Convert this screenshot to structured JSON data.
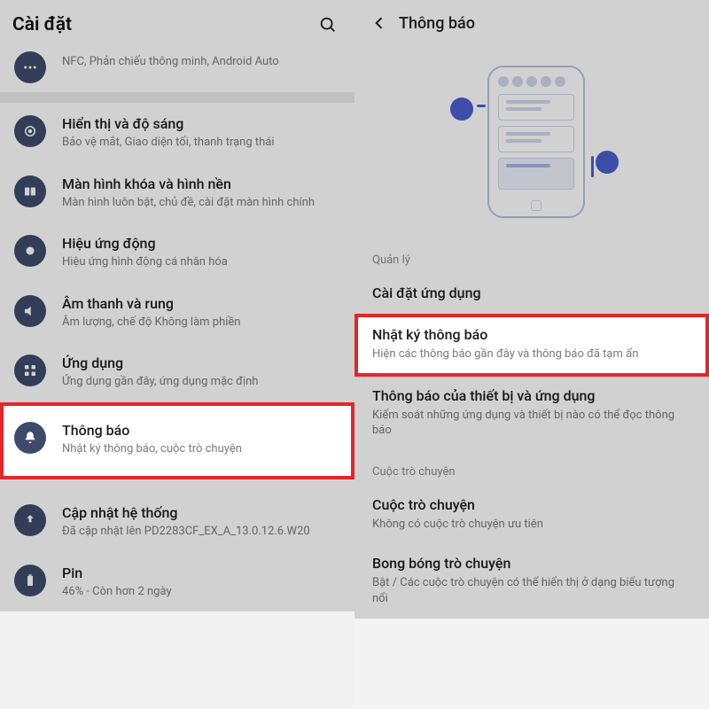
{
  "left": {
    "title": "Cài đặt",
    "items": [
      {
        "icon": "dots",
        "title": "",
        "subtitle": "NFC, Phản chiếu thông minh, Android Auto"
      },
      {
        "icon": "disc",
        "title": "Hiển thị và độ sáng",
        "subtitle": "Bảo vệ mắt, Giao diện tối, thanh trạng thái"
      },
      {
        "icon": "palette",
        "title": "Màn hình khóa và hình nền",
        "subtitle": "Màn hình luôn bật, chủ đề, cài đặt màn hình chính"
      },
      {
        "icon": "motion",
        "title": "Hiệu ứng động",
        "subtitle": "Hiệu ứng hình động cá nhân hóa"
      },
      {
        "icon": "sound",
        "title": "Âm thanh và rung",
        "subtitle": "Âm lượng, chế độ Không làm phiền"
      },
      {
        "icon": "apps",
        "title": "Ứng dụng",
        "subtitle": "Ứng dụng gần đây, ứng dụng mặc định"
      },
      {
        "icon": "bell",
        "title": "Thông báo",
        "subtitle": "Nhật ký thông báo, cuộc trò chuyện"
      },
      {
        "icon": "update",
        "title": "Cập nhật hệ thống",
        "subtitle": "Đã cập nhật lên PD2283CF_EX_A_13.0.12.6.W20"
      },
      {
        "icon": "battery",
        "title": "Pin",
        "subtitle": "46% - Còn hơn 2 ngày"
      }
    ]
  },
  "right": {
    "title": "Thông báo",
    "section_manage": "Quản lý",
    "items_manage": [
      {
        "title": "Cài đặt ứng dụng",
        "subtitle": ""
      },
      {
        "title": "Nhật ký thông báo",
        "subtitle": "Hiện các thông báo gần đây và thông báo đã tạm ẩn"
      },
      {
        "title": "Thông báo của thiết bị và ứng dụng",
        "subtitle": "Kiểm soát những ứng dụng và thiết bị nào có thể đọc thông báo"
      }
    ],
    "section_chat": "Cuộc trò chuyện",
    "items_chat": [
      {
        "title": "Cuộc trò chuyện",
        "subtitle": "Không có cuộc trò chuyện ưu tiên"
      },
      {
        "title": "Bong bóng trò chuyện",
        "subtitle": "Bật / Các cuộc trò chuyện có thể hiển thị ở dạng biểu tượng nổi"
      }
    ]
  }
}
